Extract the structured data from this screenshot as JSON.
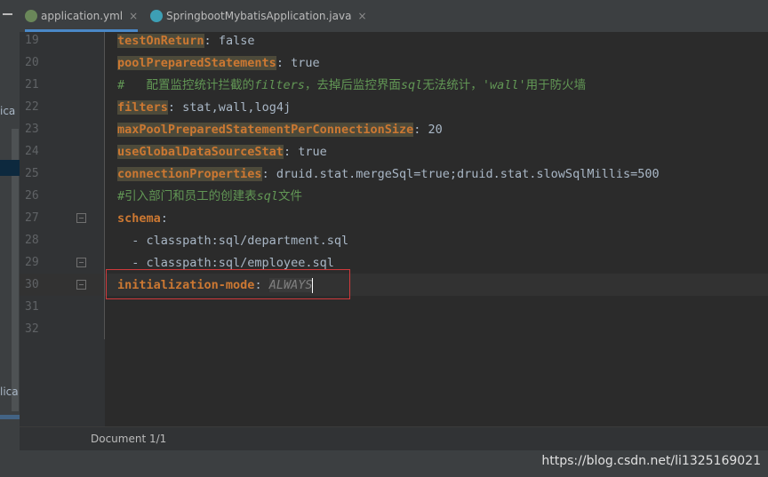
{
  "tabs": [
    {
      "label": "application.yml",
      "close": "×"
    },
    {
      "label": "SpringbootMybatisApplication.java",
      "close": "×"
    }
  ],
  "sidebar": {
    "fragment1": "ica",
    "fragment2": "lica"
  },
  "lines": [
    {
      "num": "19",
      "key": "testOnReturn",
      "sep": ": ",
      "val": "false"
    },
    {
      "num": "20",
      "key": "poolPreparedStatements",
      "sep": ": ",
      "val": "true"
    },
    {
      "num": "21",
      "c1": "#   配置监控统计拦截的",
      "c2": "filters",
      "c3": "，去掉后监控界面",
      "c4": "sql",
      "c5": "无法统计，",
      "c6": "'wall'",
      "c7": "用于防火墙"
    },
    {
      "num": "22",
      "key": "filters",
      "sep": ": ",
      "val": "stat,wall,log4j"
    },
    {
      "num": "23",
      "key": "maxPoolPreparedStatementPerConnectionSize",
      "sep": ": ",
      "val": "20"
    },
    {
      "num": "24",
      "key": "useGlobalDataSourceStat",
      "sep": ": ",
      "val": "true"
    },
    {
      "num": "25",
      "key": "connectionProperties",
      "sep": ": ",
      "val": "druid.stat.mergeSql=true;druid.stat.slowSqlMillis=500"
    },
    {
      "num": "26",
      "c1": "#引入部门和员工的创建表",
      "c2": "sql",
      "c3": "文件"
    },
    {
      "num": "27",
      "key": "schema",
      "sep": ":"
    },
    {
      "num": "28",
      "val": "  - classpath:sql/department.sql"
    },
    {
      "num": "29",
      "val": "  - classpath:sql/employee.sql"
    },
    {
      "num": "30",
      "key": "initialization-mode",
      "sep": ": ",
      "val": "ALWAYS"
    },
    {
      "num": "31"
    },
    {
      "num": "32"
    }
  ],
  "breadcrumb": "Document 1/1",
  "watermark": "https://blog.csdn.net/li1325169021"
}
